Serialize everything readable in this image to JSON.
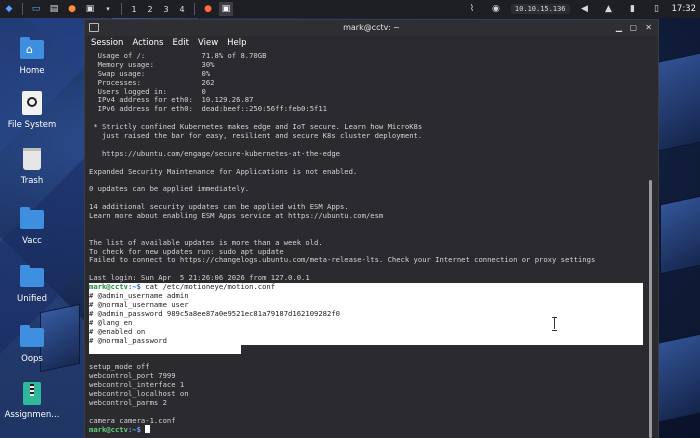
{
  "taskbar": {
    "workspaces": [
      "1",
      "2",
      "3",
      "4"
    ],
    "ip_address": "10.10.15.136",
    "clock": "17:32"
  },
  "desktop": {
    "icons": [
      {
        "label": "Home",
        "icon": "home-folder-icon"
      },
      {
        "label": "File System",
        "icon": "drive-icon"
      },
      {
        "label": "Trash",
        "icon": "trash-icon"
      },
      {
        "label": "Vacc",
        "icon": "folder-icon"
      },
      {
        "label": "Unified",
        "icon": "folder-icon"
      },
      {
        "label": "Oops",
        "icon": "folder-icon"
      },
      {
        "label": "Assignmen...",
        "icon": "zip-archive-icon"
      }
    ]
  },
  "terminal": {
    "title": "mark@cctv: ~",
    "menu": [
      "Session",
      "Actions",
      "Edit",
      "View",
      "Help"
    ],
    "motd_lines": [
      "  Usage of /:             71.8% of 8.70GB",
      "  Memory usage:           30%",
      "  Swap usage:             0%",
      "  Processes:              262",
      "  Users logged in:        0",
      "  IPv4 address for eth0:  10.129.26.87",
      "  IPv6 address for eth0:  dead:beef::250:56ff:feb0:5f11",
      "",
      " * Strictly confined Kubernetes makes edge and IoT secure. Learn how MicroK8s",
      "   just raised the bar for easy, resilient and secure K8s cluster deployment.",
      "",
      "   https://ubuntu.com/engage/secure-kubernetes-at-the-edge",
      "",
      "Expanded Security Maintenance for Applications is not enabled.",
      "",
      "0 updates can be applied immediately.",
      "",
      "14 additional security updates can be applied with ESM Apps.",
      "Learn more about enabling ESM Apps service at https://ubuntu.com/esm",
      "",
      "",
      "The list of available updates is more than a week old.",
      "To check for new updates run: sudo apt update",
      "Failed to connect to https://changelogs.ubuntu.com/meta-release-lts. Check your Internet connection or proxy settings",
      "",
      "Last login: Sun Apr  5 21:26:06 2026 from 127.0.0.1"
    ],
    "prompt_user": "mark@cctv",
    "prompt_path": ":~$",
    "command": " cat /etc/motioneye/motion.conf",
    "selected_lines": [
      "# @admin_username admin",
      "# @normal_username user",
      "# @admin_password 989c5a8ee87a0e9521ec81a79187d162109282f0",
      "# @lang en",
      "# @enabled on",
      "# @normal_password",
      ""
    ],
    "config_lines": [
      "",
      "setup_mode off",
      "webcontrol_port 7999",
      "webcontrol_interface 1",
      "webcontrol_localhost on",
      "webcontrol_parms 2",
      "",
      "camera camera-1.conf"
    ],
    "final_prompt_user": "mark@cctv",
    "final_prompt_path": ":~$"
  }
}
